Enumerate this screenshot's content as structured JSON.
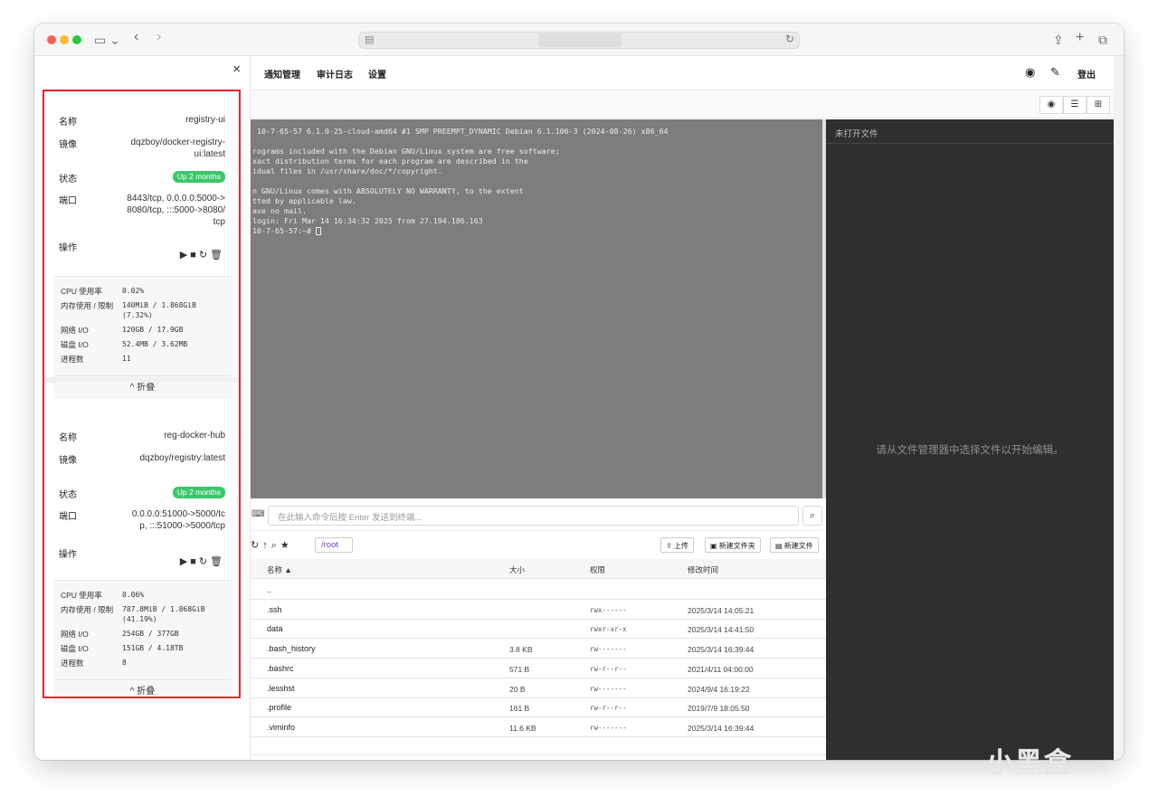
{
  "browser": {
    "traffic_colors": [
      "#fe5f57",
      "#febc2e",
      "#28c840"
    ],
    "icons": [
      "sidebar-icon",
      "back-icon",
      "forward-icon",
      "share-icon",
      "new-tab-icon",
      "tabs-overview-icon"
    ]
  },
  "panel": {
    "close_label": "×",
    "containers": [
      {
        "name_key": "名称",
        "name": "registry-ui",
        "image_key": "镜像",
        "image": "dqzboy/docker-registry-ui:latest",
        "status_key": "状态",
        "status": "Up 2 months",
        "ports_key": "端口",
        "ports": "8443/tcp, 0.0.0.0:5000->8080/tcp, :::5000->8080/tcp",
        "ops_key": "操作",
        "stats": [
          {
            "k": "CPU 使用率",
            "v": "0.02%"
          },
          {
            "k": "内存使用 / 限制",
            "v": "140MiB / 1.868GiB (7.32%)"
          },
          {
            "k": "网络 I/O",
            "v": "120GB / 17.9GB"
          },
          {
            "k": "磁盘 I/O",
            "v": "52.4MB / 3.62MB"
          },
          {
            "k": "进程数",
            "v": "11"
          }
        ],
        "collapse": "^ 折叠"
      },
      {
        "name_key": "名称",
        "name": "reg-docker-hub",
        "image_key": "镜像",
        "image": "dqzboy/registry:latest",
        "status_key": "状态",
        "status": "Up 2 months",
        "ports_key": "端口",
        "ports": "0.0.0.0:51000->5000/tcp, :::51000->5000/tcp",
        "ops_key": "操作",
        "stats": [
          {
            "k": "CPU 使用率",
            "v": "0.06%"
          },
          {
            "k": "内存使用 / 限制",
            "v": "787.8MiB / 1.868GiB (41.19%)"
          },
          {
            "k": "网络 I/O",
            "v": "254GB / 377GB"
          },
          {
            "k": "磁盘 I/O",
            "v": "151GB / 4.18TB"
          },
          {
            "k": "进程数",
            "v": "8"
          }
        ],
        "collapse": "^ 折叠"
      }
    ]
  },
  "nav": {
    "items": [
      "通知管理",
      "审计日志",
      "设置"
    ],
    "logout": "登出"
  },
  "terminal": {
    "lines": [
      " 10-7-65-57 6.1.0-25-cloud-amd64 #1 SMP PREEMPT_DYNAMIC Debian 6.1.106-3 (2024-08-26) x86_64",
      "",
      "rograms included with the Debian GNU/Linux system are free software;",
      "xact distribution terms for each program are described in the",
      "idual files in /usr/share/doc/*/copyright.",
      "",
      "n GNU/Linux comes with ABSOLUTELY NO WARRANTY, to the extent",
      "tted by applicable law.",
      "ave no mail.",
      "login: Fri Mar 14 16:34:32 2025 from 27.194.186.163",
      "10-7-65-57:~# "
    ]
  },
  "editor": {
    "title": "未打开文件",
    "message": "请从文件管理器中选择文件以开始编辑。"
  },
  "command": {
    "placeholder": "在此输入命令后按 Enter 发送到终端..."
  },
  "file_manager": {
    "path": "/root",
    "buttons": {
      "upload": "上传",
      "new_folder": "新建文件夹",
      "new_file": "新建文件"
    },
    "columns": {
      "name": "名称 ▲",
      "size": "大小",
      "perm": "权限",
      "modified": "修改时间"
    },
    "rows": [
      {
        "name": "..",
        "size": "",
        "perm": "",
        "modified": ""
      },
      {
        "name": ".ssh",
        "size": "",
        "perm": "rwx------",
        "modified": "2025/3/14 14:05:21"
      },
      {
        "name": "data",
        "size": "",
        "perm": "rwxr-xr-x",
        "modified": "2025/3/14 14:41:50"
      },
      {
        "name": ".bash_history",
        "size": "3.8 KB",
        "perm": "rw-------",
        "modified": "2025/3/14 16:39:44"
      },
      {
        "name": ".bashrc",
        "size": "571 B",
        "perm": "rw-r--r--",
        "modified": "2021/4/11 04:00:00"
      },
      {
        "name": ".lesshst",
        "size": "20 B",
        "perm": "rw-------",
        "modified": "2024/9/4 16:19:22"
      },
      {
        "name": ".profile",
        "size": "161 B",
        "perm": "rw-r--r--",
        "modified": "2019/7/9 18:05:50"
      },
      {
        "name": ".viminfo",
        "size": "11.6 KB",
        "perm": "rw-------",
        "modified": "2025/3/14 16:39:44"
      }
    ]
  },
  "watermark": "小黑盒"
}
